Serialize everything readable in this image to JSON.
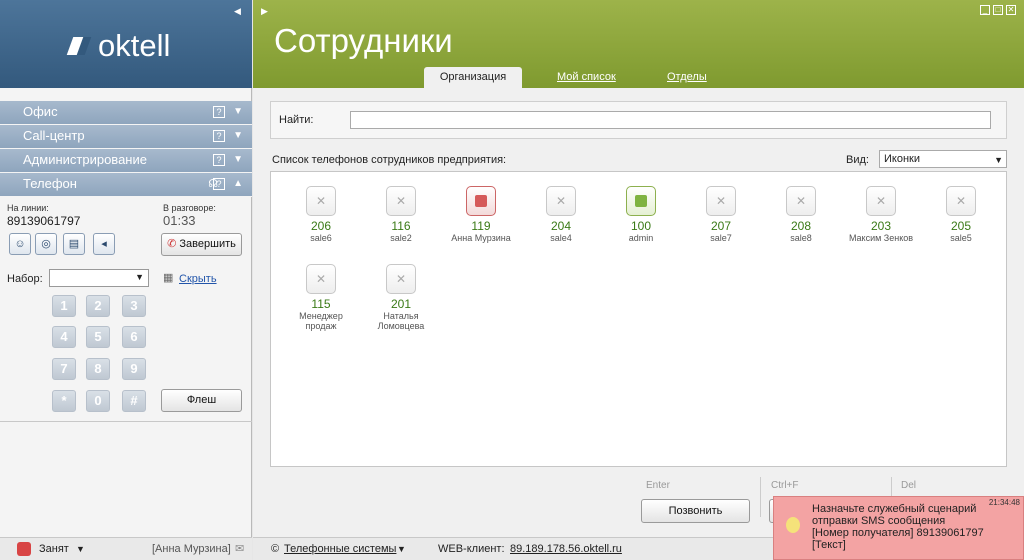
{
  "logo": {
    "text": "oktell"
  },
  "sidebar": {
    "sections": [
      {
        "label": "Офис"
      },
      {
        "label": "Call-центр"
      },
      {
        "label": "Администрирование"
      },
      {
        "label": "Телефон"
      }
    ],
    "phone": {
      "on_line_label": "На линии:",
      "on_line_number": "89139061797",
      "in_call_label": "В разговоре:",
      "in_call_time": "01:33",
      "hangup_label": "Завершить",
      "dial_label": "Набор:",
      "hide_label": "Скрыть",
      "flash_label": "Флеш",
      "keys": [
        "1",
        "2",
        "3",
        "4",
        "5",
        "6",
        "7",
        "8",
        "9",
        "*",
        "0",
        "#"
      ]
    },
    "status": {
      "state": "Занят",
      "user": "[Анна Мурзина]"
    }
  },
  "header": {
    "title": "Сотрудники"
  },
  "tabs": [
    {
      "label": "Организация",
      "active": true
    },
    {
      "label": "Мой список",
      "active": false
    },
    {
      "label": "Отделы",
      "active": false
    }
  ],
  "search": {
    "label": "Найти:",
    "value": ""
  },
  "list": {
    "title": "Список телефонов сотрудников предприятия:",
    "view_label": "Вид:",
    "view_value": "Иконки"
  },
  "employees": [
    {
      "number": "206",
      "name": "sale6",
      "state": "offline"
    },
    {
      "number": "116",
      "name": "sale2",
      "state": "offline"
    },
    {
      "number": "119",
      "name": "Анна Мурзина",
      "state": "busy"
    },
    {
      "number": "204",
      "name": "sale4",
      "state": "offline"
    },
    {
      "number": "100",
      "name": "admin",
      "state": "free"
    },
    {
      "number": "207",
      "name": "sale7",
      "state": "offline"
    },
    {
      "number": "208",
      "name": "sale8",
      "state": "offline"
    },
    {
      "number": "203",
      "name": "Максим Зенков",
      "state": "offline"
    },
    {
      "number": "205",
      "name": "sale5",
      "state": "offline"
    },
    {
      "number": "115",
      "name": "Менеджер продаж",
      "state": "offline"
    },
    {
      "number": "201",
      "name": "Наталья Ломовцева",
      "state": "offline"
    }
  ],
  "actions": {
    "call_hint": "Enter",
    "call_label": "Позвонить",
    "ctrlf_hint": "Ctrl+F",
    "del_hint": "Del"
  },
  "statusbar": {
    "systems_label": "Телефонные системы",
    "web_client_label": "WEB-клиент:",
    "web_client_url": "89.189.178.56.oktell.ru"
  },
  "notification": {
    "time": "21:34:48",
    "line1": "Назначьте служебный сценарий",
    "line2": "отправки SMS сообщения",
    "line3": "[Номер получателя] 89139061797",
    "line4": "[Текст]"
  },
  "colors": {
    "left_header": "#3f6890",
    "right_header": "#8ea83c",
    "accordion": "#9bb0c6",
    "number_green": "#3a7a16",
    "toast": "#f3a3a3"
  }
}
